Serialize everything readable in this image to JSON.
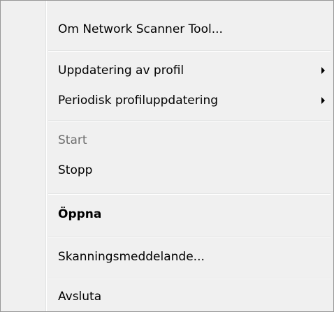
{
  "menu": {
    "items": [
      {
        "label": "Om Network Scanner Tool..."
      },
      {
        "label": "Uppdatering av profil",
        "submenu": true
      },
      {
        "label": "Periodisk profiluppdatering",
        "submenu": true
      },
      {
        "label": "Start",
        "disabled": true
      },
      {
        "label": "Stopp"
      },
      {
        "label": "Öppna",
        "default": true
      },
      {
        "label": "Skanningsmeddelande..."
      },
      {
        "label": "Avsluta"
      }
    ]
  },
  "icons": {
    "submenu_arrow": "chevron-right-icon"
  },
  "colors": {
    "background": "#f0f0f0",
    "border": "#979797",
    "disabled_text": "#6d6d6d",
    "separator": "#e2e3e3"
  }
}
